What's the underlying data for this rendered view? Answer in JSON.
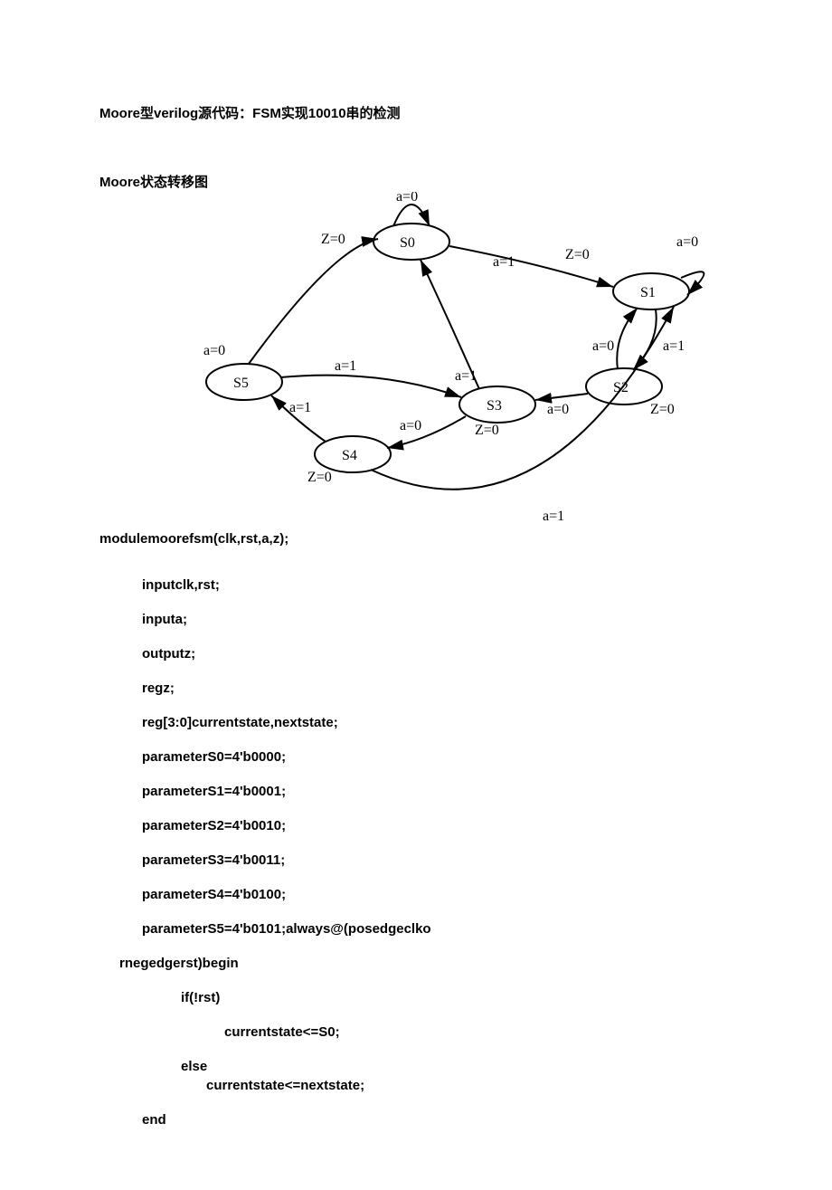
{
  "title": "Moore型verilog源代码：FSM实现10010串的检测",
  "subtitle": "Moore状态转移图",
  "diagram": {
    "states": [
      {
        "id": "S0",
        "label": "S0",
        "output": "Z=0"
      },
      {
        "id": "S1",
        "label": "S1",
        "output": "Z=0"
      },
      {
        "id": "S2",
        "label": "S2",
        "output": "Z=0"
      },
      {
        "id": "S3",
        "label": "S3",
        "output": "Z=0"
      },
      {
        "id": "S4",
        "label": "S4",
        "output": "Z=0"
      },
      {
        "id": "S5",
        "label": "S5",
        "output": ""
      }
    ],
    "transitions": [
      {
        "from": "S0",
        "to": "S0",
        "label": "a=0"
      },
      {
        "from": "S0",
        "to": "S1",
        "label": "a=1"
      },
      {
        "from": "S1",
        "to": "S1",
        "label": "a=1"
      },
      {
        "from": "S1",
        "to": "S2",
        "label": "a=0"
      },
      {
        "from": "S2",
        "to": "S1",
        "label": "a=1"
      },
      {
        "from": "S2",
        "to": "S3",
        "label": "a=0"
      },
      {
        "from": "S3",
        "to": "S0",
        "label": "a=0"
      },
      {
        "from": "S3",
        "to": "S4",
        "label": "a=1"
      },
      {
        "from": "S4",
        "to": "S5",
        "label": "a=0"
      },
      {
        "from": "S4",
        "to": "S1",
        "label": "a=1"
      },
      {
        "from": "S5",
        "to": "S1",
        "label": "a=1"
      },
      {
        "from": "S5",
        "to": "S3",
        "label": "a=0"
      }
    ]
  },
  "code": {
    "module_decl": "modulemoorefsm(clk,rst,a,z);",
    "input1": "inputclk,rst;",
    "input2": "inputa;",
    "output": "outputz;",
    "regz": "regz;",
    "regstate": "reg[3:0]currentstate,nextstate;",
    "param_s0": "parameterS0=4'b0000;",
    "param_s1": "parameterS1=4'b0001;",
    "param_s2": "parameterS2=4'b0010;",
    "param_s3": "parameterS3=4'b0011;",
    "param_s4": "parameterS4=4'b0100;",
    "param_s5_always": "parameterS5=4'b0101;always@(posedgeclko",
    "rnegedge": "rnegedgerst)begin",
    "if_rst": "if(!rst)",
    "cur_s0": "currentstate<=S0;",
    "else_kw": "else",
    "cur_next": "currentstate<=nextstate;",
    "end_kw": "end"
  }
}
